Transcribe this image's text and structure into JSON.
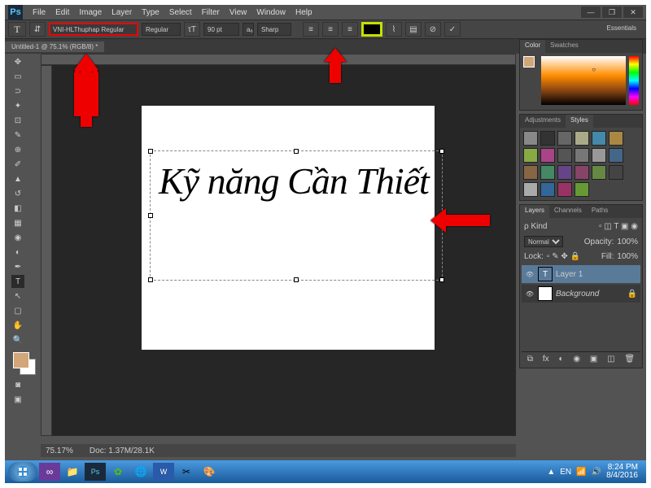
{
  "menu": {
    "items": [
      "File",
      "Edit",
      "Image",
      "Layer",
      "Type",
      "Select",
      "Filter",
      "View",
      "Window",
      "Help"
    ]
  },
  "optbar": {
    "font": "VNI-HLThuphap Regular",
    "style": "Regular",
    "size": "90 pt",
    "aa": "Sharp"
  },
  "doctab": "Untitled-1 @ 75.1% (RGB/8) *",
  "canvas_text": "Kỹ năng Cần Thiết",
  "panels": {
    "color_tab": "Color",
    "swatches_tab": "Swatches",
    "adjust_tab": "Adjustments",
    "styles_tab": "Styles",
    "layers_tab": "Layers",
    "channels_tab": "Channels",
    "paths_tab": "Paths",
    "blend": "Normal",
    "opacity_label": "Opacity:",
    "opacity": "100%",
    "fill_label": "Fill:",
    "fill": "100%",
    "lock_label": "Lock:",
    "layer1": "Layer 1",
    "bg": "Background"
  },
  "status": {
    "zoom": "75.17%",
    "doc": "Doc: 1.37M/28.1K"
  },
  "essentials": "Essentials",
  "adjust_colors": [
    "#888",
    "#333",
    "#666",
    "#aa8",
    "#48a",
    "#a84",
    "#8a4",
    "#a48",
    "#555",
    "#777",
    "#999",
    "#468",
    "#864",
    "#486",
    "#648",
    "#846",
    "#684",
    "#444",
    "#aaa",
    "#369",
    "#936",
    "#693"
  ],
  "taskbar": {
    "time": "8:24 PM",
    "date": "8/4/2016",
    "lang": "EN"
  }
}
